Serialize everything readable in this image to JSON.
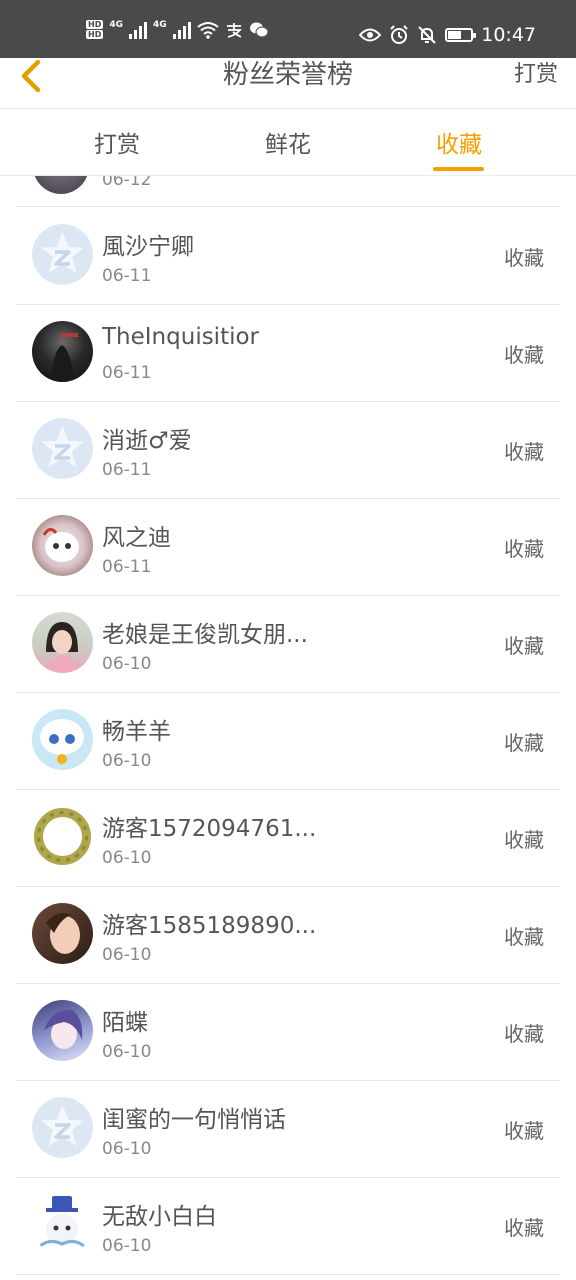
{
  "status_bar": {
    "network_left": "4G",
    "network_right": "4G",
    "time": "10:47"
  },
  "header": {
    "title": "粉丝荣誉榜",
    "right_link": "打赏"
  },
  "tabs": [
    {
      "label": "打赏",
      "active": false
    },
    {
      "label": "鲜花",
      "active": false
    },
    {
      "label": "收藏",
      "active": true
    }
  ],
  "accent_color": "#f5a000",
  "list": {
    "partial_item": {
      "date": "06-12"
    },
    "items": [
      {
        "name": "風沙宁卿",
        "date": "06-11",
        "action": "收藏",
        "avatar": "default-avatar"
      },
      {
        "name": "TheInquisitior",
        "date": "06-11",
        "action": "收藏",
        "avatar": "photo-dark"
      },
      {
        "name": "消逝♂爱",
        "date": "06-11",
        "action": "收藏",
        "avatar": "default-avatar"
      },
      {
        "name": "风之迪",
        "date": "06-11",
        "action": "收藏",
        "avatar": "photo-cartoon-sheep"
      },
      {
        "name": "老娘是王俊凯女朋...",
        "date": "06-10",
        "action": "收藏",
        "avatar": "photo-girl"
      },
      {
        "name": "畅羊羊",
        "date": "06-10",
        "action": "收藏",
        "avatar": "photo-cartoon-goat"
      },
      {
        "name": "游客1572094761...",
        "date": "06-10",
        "action": "收藏",
        "avatar": "photo-wreath"
      },
      {
        "name": "游客1585189890...",
        "date": "06-10",
        "action": "收藏",
        "avatar": "photo-woman"
      },
      {
        "name": "陌蝶",
        "date": "06-10",
        "action": "收藏",
        "avatar": "photo-anime"
      },
      {
        "name": "闺蜜的一句悄悄话",
        "date": "06-10",
        "action": "收藏",
        "avatar": "default-avatar"
      },
      {
        "name": "无敌小白白",
        "date": "06-10",
        "action": "收藏",
        "avatar": "photo-cartoon-white"
      }
    ]
  }
}
